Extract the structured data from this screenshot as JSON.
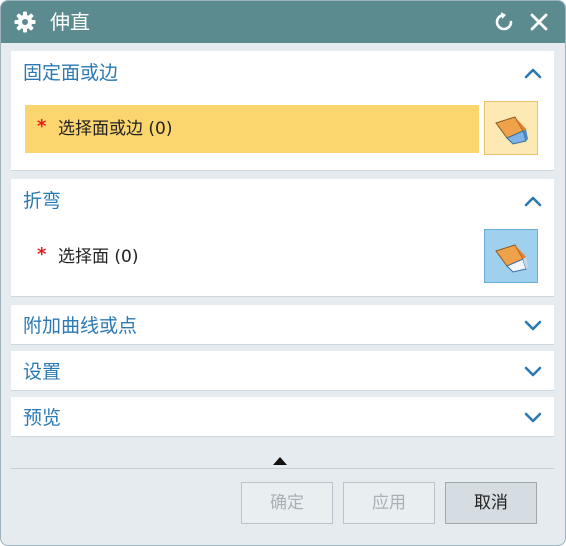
{
  "window": {
    "title": "伸直"
  },
  "sections": {
    "fixed": {
      "title": "固定面或边",
      "selection_label": "选择面或边 (0)",
      "required_mark": "*"
    },
    "bend": {
      "title": "折弯",
      "selection_label": "选择面 (0)",
      "required_mark": "*"
    },
    "curves": {
      "title": "附加曲线或点"
    },
    "settings": {
      "title": "设置"
    },
    "preview": {
      "title": "预览"
    }
  },
  "buttons": {
    "ok": "确定",
    "apply": "应用",
    "cancel": "取消"
  },
  "colors": {
    "title_bar": "#5b8b8f",
    "section_title": "#2b7ab4",
    "active_selection": "#fbd56e",
    "required_star": "#e02020"
  },
  "icons": {
    "title": "gear-icon",
    "reset": "reset-icon",
    "close": "close-icon",
    "select_face": "select-face-icon"
  }
}
